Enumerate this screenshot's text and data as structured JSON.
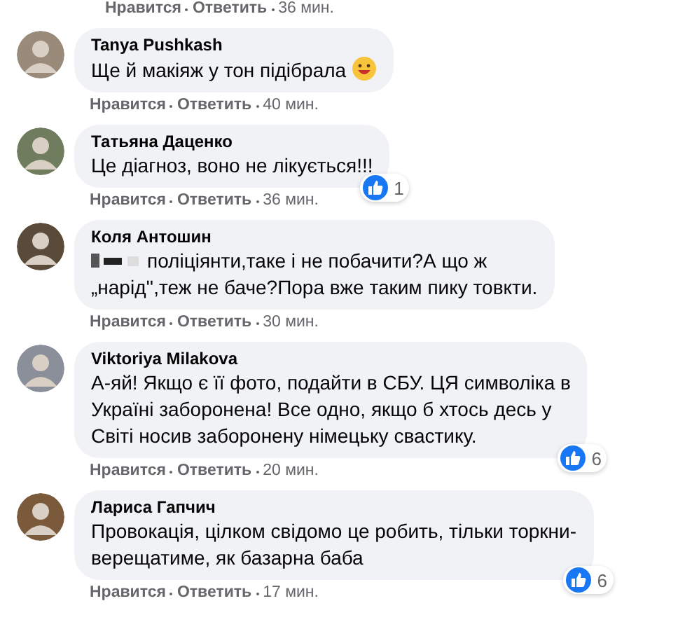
{
  "top_actions": {
    "like": "Нравится",
    "reply": "Ответить",
    "time": "36 мин."
  },
  "comments": [
    {
      "author": "Tanya Pushkash",
      "text": "Ще й макіяж у тон підібрала",
      "emoji": true,
      "redacted": false,
      "like": "Нравится",
      "reply": "Ответить",
      "time": "40 мин."
    },
    {
      "author": "Татьяна Даценко",
      "text": "Це діагноз, воно не лікується!!!",
      "emoji": false,
      "redacted": false,
      "reactions": "1",
      "like": "Нравится",
      "reply": "Ответить",
      "time": "36 мин."
    },
    {
      "author": "Коля Антошин",
      "text": "поліціянти,таке і не побачити?А що ж\n„нарід'',теж не баче?Пора вже таким пику товкти.",
      "emoji": false,
      "redacted": true,
      "like": "Нравится",
      "reply": "Ответить",
      "time": "30 мин."
    },
    {
      "author": "Viktoriya Milakova",
      "text": "А-яй! Якщо є її фото, подайти в СБУ. ЦЯ символіка в\nУкраїні заборонена! Все одно, якщо б хтось десь у\nСвіті носив заборонену німецьку свастику.",
      "emoji": false,
      "redacted": false,
      "reactions": "6",
      "like": "Нравится",
      "reply": "Ответить",
      "time": "20 мин."
    },
    {
      "author": "Лариса Гапчич",
      "text": "Провокація, цілком свідомо це робить, тільки торкни-\nверещатиме, як базарна баба",
      "emoji": false,
      "redacted": false,
      "reactions": "6",
      "like": "Нравится",
      "reply": "Ответить",
      "time": "17 мин."
    }
  ]
}
